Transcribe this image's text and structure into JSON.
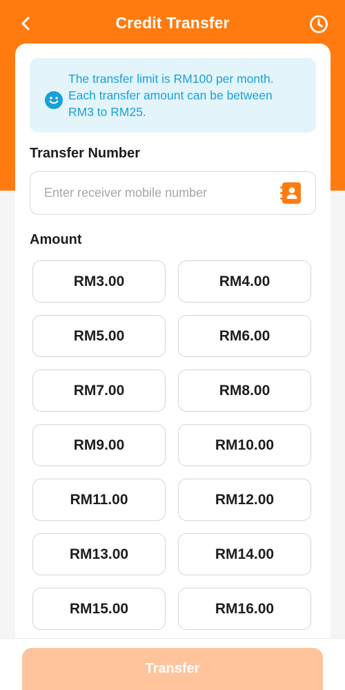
{
  "header": {
    "title": "Credit Transfer",
    "back_icon": "chevron-left-icon",
    "history_icon": "clock-icon",
    "color": "#ff7b10"
  },
  "notice": {
    "lines": [
      "The transfer limit is RM100 per month.",
      "Each transfer amount can be between",
      "RM3 to RM25."
    ],
    "icon": "smiley-icon",
    "color": "#1aa0d8"
  },
  "transfer_number": {
    "label": "Transfer Number",
    "placeholder": "Enter receiver mobile number",
    "value": "",
    "contact_icon": "contact-book-icon"
  },
  "amount": {
    "label": "Amount",
    "options": [
      "RM3.00",
      "RM4.00",
      "RM5.00",
      "RM6.00",
      "RM7.00",
      "RM8.00",
      "RM9.00",
      "RM10.00",
      "RM11.00",
      "RM12.00",
      "RM13.00",
      "RM14.00",
      "RM15.00",
      "RM16.00"
    ]
  },
  "footer": {
    "transfer_label": "Transfer",
    "button_color": "#ffc49c"
  }
}
